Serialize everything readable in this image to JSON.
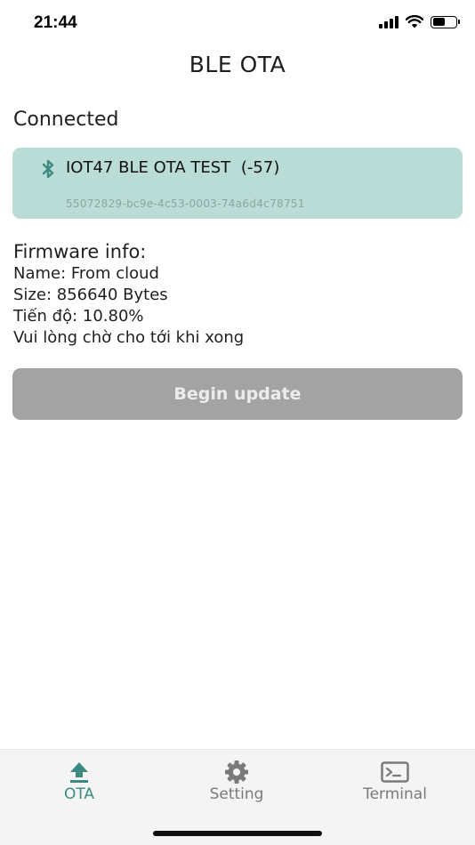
{
  "status_bar": {
    "time": "21:44"
  },
  "header": {
    "title": "BLE OTA"
  },
  "connection": {
    "label": "Connected",
    "device_name": "IOT47 BLE OTA TEST",
    "rssi": "(-57)",
    "device_uuid": "55072829-bc9e-4c53-0003-74a6d4c78751"
  },
  "firmware": {
    "title": "Firmware info:",
    "name_line": "Name: From cloud",
    "size_line": "Size: 856640 Bytes",
    "progress_line": "Tiến độ: 10.80%",
    "wait_line": "Vui lòng chờ cho tới khi xong"
  },
  "actions": {
    "begin_update": "Begin update"
  },
  "nav": {
    "items": [
      {
        "label": "OTA",
        "icon": "upload-icon",
        "active": true
      },
      {
        "label": "Setting",
        "icon": "gear-icon",
        "active": false
      },
      {
        "label": "Terminal",
        "icon": "terminal-icon",
        "active": false
      }
    ]
  },
  "colors": {
    "accent": "#3d8b80",
    "card_bg": "#b9dcd6",
    "button_disabled": "#a3a3a3"
  }
}
